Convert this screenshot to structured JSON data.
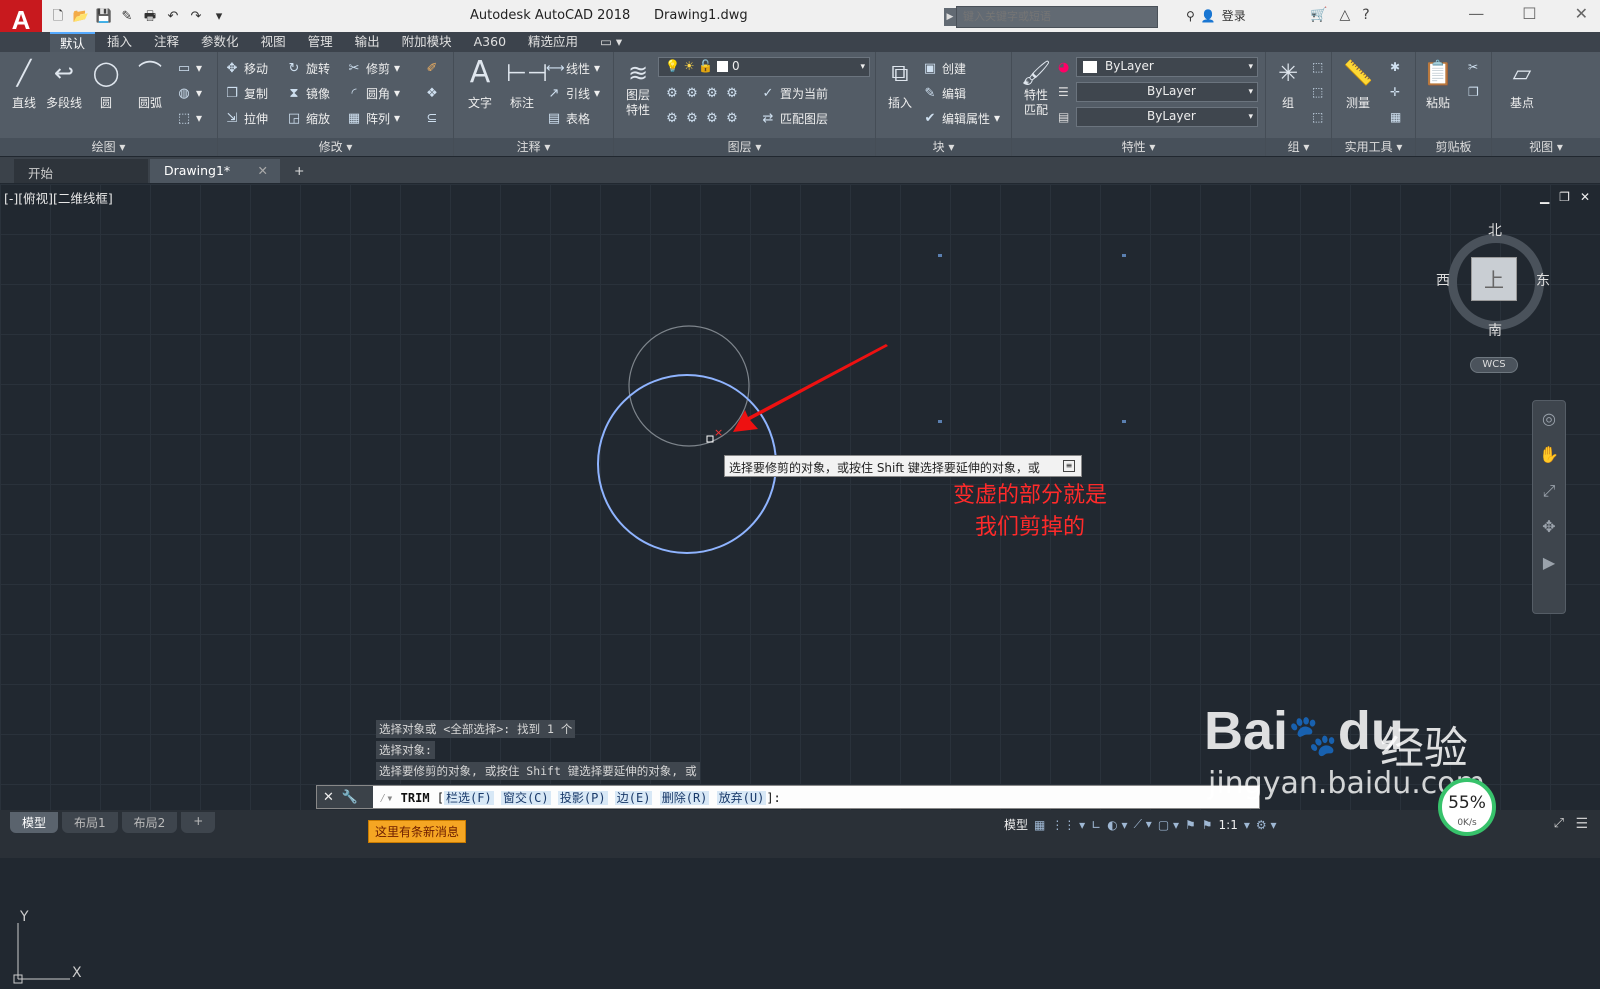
{
  "app": {
    "logo": "A",
    "title": "Autodesk AutoCAD 2018",
    "file": "Drawing1.dwg",
    "search_placeholder": "键入关键字或短语",
    "login": "登录"
  },
  "ribbon_tabs": [
    "默认",
    "插入",
    "注释",
    "参数化",
    "视图",
    "管理",
    "输出",
    "附加模块",
    "A360",
    "精选应用"
  ],
  "ribbon": {
    "draw": {
      "footer": "绘图",
      "line": "直线",
      "polyline": "多段线",
      "circle": "圆",
      "arc": "圆弧"
    },
    "modify": {
      "footer": "修改",
      "move": "移动",
      "rotate": "旋转",
      "trim": "修剪",
      "copy": "复制",
      "mirror": "镜像",
      "fillet": "圆角",
      "stretch": "拉伸",
      "scale": "缩放",
      "array": "阵列"
    },
    "annotation": {
      "footer": "注释",
      "text": "文字",
      "dimension": "标注",
      "linear": "线性",
      "leader": "引线",
      "table": "表格"
    },
    "layers": {
      "footer": "图层",
      "layer_props": "图层\n特性",
      "layer_value": "0",
      "make_current": "置为当前",
      "match_layer": "匹配图层"
    },
    "block": {
      "footer": "块",
      "insert": "插入",
      "create": "创建",
      "edit": "编辑",
      "edit_attr": "编辑属性"
    },
    "properties": {
      "footer": "特性",
      "match": "特性\n匹配",
      "color": "ByLayer",
      "linetype": "ByLayer",
      "lineweight": "ByLayer"
    },
    "groups": {
      "footer": "组",
      "group": "组"
    },
    "utilities": {
      "footer": "实用工具",
      "measure": "测量"
    },
    "clipboard": {
      "footer": "剪贴板",
      "paste": "粘贴"
    },
    "view": {
      "footer": "视图",
      "base": "基点"
    }
  },
  "doc_tabs": {
    "start": "开始",
    "drawing": "Drawing1*",
    "add": "+"
  },
  "viewport": {
    "label": "[-][俯视][二维线框]",
    "viewcube": {
      "north": "北",
      "south": "南",
      "west": "西",
      "east": "东",
      "face": "上"
    },
    "wcs": "WCS"
  },
  "annotation": {
    "line1": "变虚的部分就是",
    "line2": "我们剪掉的"
  },
  "tooltip": "选择要修剪的对象，或按住 Shift 键选择要延伸的对象，或",
  "command_history": [
    "选择对象或 <全部选择>:  找到 1 个",
    "选择对象:",
    "选择要修剪的对象, 或按住 Shift 键选择要延伸的对象, 或"
  ],
  "command_line": {
    "cmd": "TRIM",
    "options": [
      "栏选(F)",
      "窗交(C)",
      "投影(P)",
      "边(E)",
      "删除(R)",
      "放弃(U)"
    ],
    "suffix": "]:"
  },
  "status": {
    "layouts": [
      "模型",
      "布局1",
      "布局2"
    ],
    "new_message": "这里有条新消息",
    "model": "模型",
    "scale": "1:1",
    "perf_pct": "55%",
    "perf_speed": "0K/s"
  },
  "ucs": {
    "x": "X",
    "y": "Y"
  },
  "watermark": {
    "main": "Bai",
    "du": "du",
    "cn": "经验",
    "url": "jingyan.baidu.com"
  },
  "colors": {
    "accent": "#55aaff",
    "canvas": "#212830",
    "annotation": "#ff2a2a",
    "selected_circle": "#8fb4ff"
  }
}
